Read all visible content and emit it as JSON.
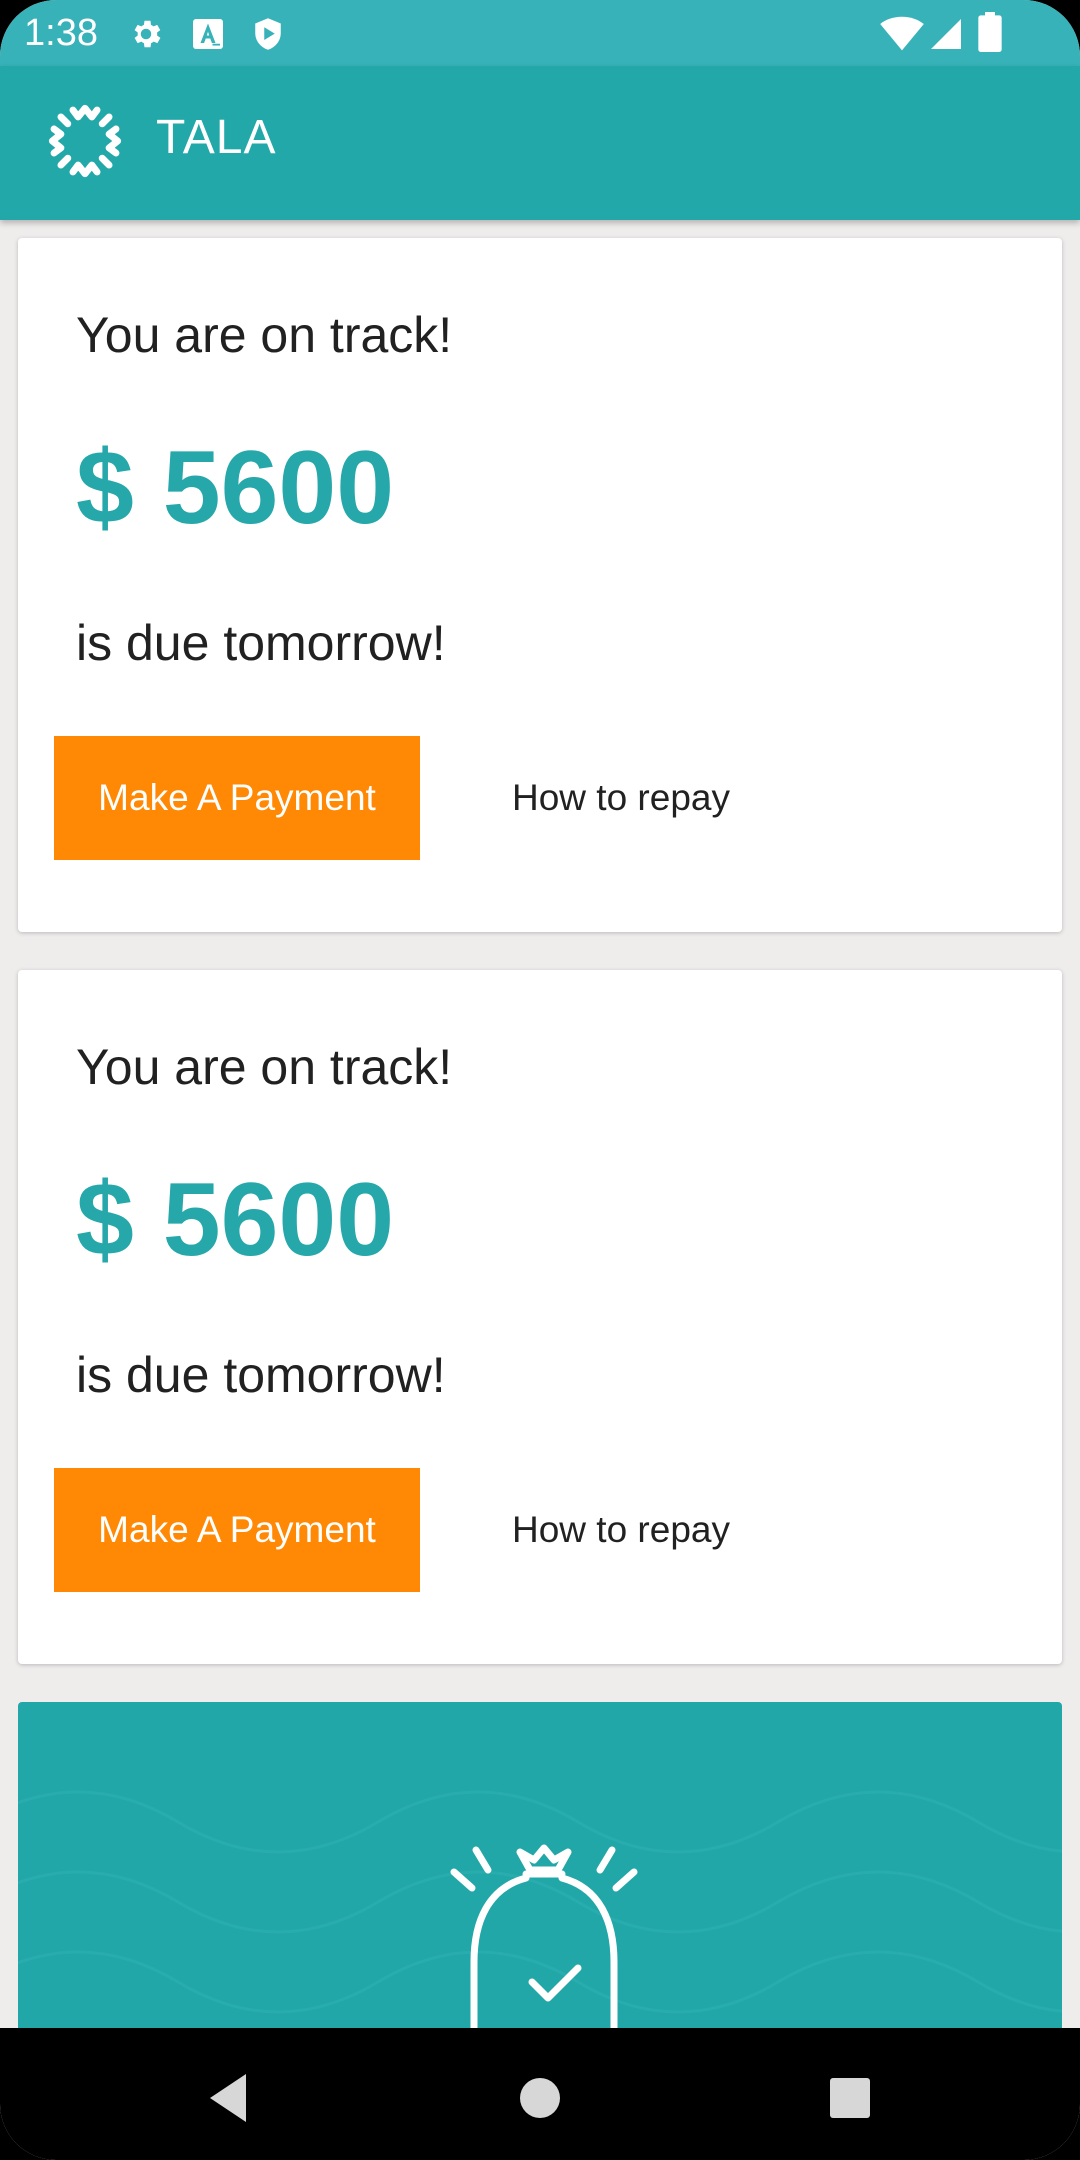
{
  "status_bar": {
    "time": "1:38",
    "left_icons": [
      "gear-icon",
      "font-a-icon",
      "play-shield-icon"
    ],
    "right_icons": [
      "wifi-icon",
      "cell-signal-icon",
      "battery-icon"
    ],
    "color": "#38b2b9"
  },
  "app_bar": {
    "title": "TALA",
    "logo_icon": "tala-star-logo",
    "color": "#23a8a9"
  },
  "cards": [
    {
      "status_text": "You are on track!",
      "amount": "$ 5600",
      "due_text": "is due tomorrow!",
      "primary_button_label": "Make A Payment",
      "secondary_link_label": "How to repay"
    },
    {
      "status_text": "You are on track!",
      "amount": "$ 5600",
      "due_text": "is due tomorrow!",
      "primary_button_label": "Make A Payment",
      "secondary_link_label": "How to repay"
    }
  ],
  "promo_card": {
    "icon": "money-bag-check-icon",
    "color": "#22a7a8"
  },
  "nav_bar": {
    "buttons": [
      "back-icon",
      "home-icon",
      "recents-icon"
    ]
  },
  "colors": {
    "accent": "#26a8aa",
    "button": "#ff8905",
    "background": "#efecec"
  }
}
